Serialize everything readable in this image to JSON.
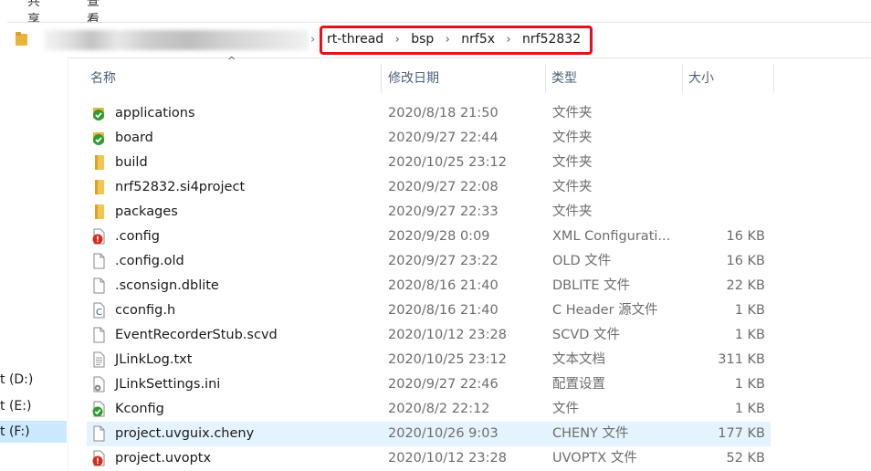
{
  "ribbon": {
    "tabs": [
      "共享",
      "查看"
    ]
  },
  "address": {
    "crumbs": [
      "rt-thread",
      "bsp",
      "nrf5x",
      "nrf52832"
    ],
    "highlight_color": "#e2121b"
  },
  "nav": {
    "drives": [
      {
        "label": "t (D:)",
        "selected": false
      },
      {
        "label": "t (E:)",
        "selected": false
      },
      {
        "label": "t (F:)",
        "selected": true
      }
    ]
  },
  "columns": {
    "name": "名称",
    "date": "修改日期",
    "type": "类型",
    "size": "大小"
  },
  "files": [
    {
      "icon": "folder-git-ok-icon",
      "name": "applications",
      "date": "2020/8/18 21:50",
      "type": "文件夹",
      "size": ""
    },
    {
      "icon": "folder-git-ok-icon",
      "name": "board",
      "date": "2020/9/27 22:44",
      "type": "文件夹",
      "size": ""
    },
    {
      "icon": "folder-icon",
      "name": "build",
      "date": "2020/10/25 23:12",
      "type": "文件夹",
      "size": ""
    },
    {
      "icon": "folder-icon",
      "name": "nrf52832.si4project",
      "date": "2020/9/27 22:08",
      "type": "文件夹",
      "size": ""
    },
    {
      "icon": "folder-icon",
      "name": "packages",
      "date": "2020/9/27 22:33",
      "type": "文件夹",
      "size": ""
    },
    {
      "icon": "file-git-modified-icon",
      "name": ".config",
      "date": "2020/9/28 0:09",
      "type": "XML Configurati...",
      "size": "16 KB"
    },
    {
      "icon": "file-icon",
      "name": ".config.old",
      "date": "2020/9/27 23:22",
      "type": "OLD 文件",
      "size": "16 KB"
    },
    {
      "icon": "file-icon",
      "name": ".sconsign.dblite",
      "date": "2020/8/16 21:40",
      "type": "DBLITE 文件",
      "size": "22 KB"
    },
    {
      "icon": "c-header-icon",
      "name": "cconfig.h",
      "date": "2020/8/16 21:40",
      "type": "C Header 源文件",
      "size": "1 KB"
    },
    {
      "icon": "file-icon",
      "name": "EventRecorderStub.scvd",
      "date": "2020/10/12 23:28",
      "type": "SCVD 文件",
      "size": "1 KB"
    },
    {
      "icon": "text-file-icon",
      "name": "JLinkLog.txt",
      "date": "2020/10/25 23:12",
      "type": "文本文档",
      "size": "311 KB"
    },
    {
      "icon": "settings-file-icon",
      "name": "JLinkSettings.ini",
      "date": "2020/9/27 22:46",
      "type": "配置设置",
      "size": "1 KB"
    },
    {
      "icon": "file-git-ok-icon",
      "name": "Kconfig",
      "date": "2020/8/2 22:12",
      "type": "文件",
      "size": "1 KB"
    },
    {
      "icon": "file-icon",
      "name": "project.uvguix.cheny",
      "date": "2020/10/26 9:03",
      "type": "CHENY 文件",
      "size": "177 KB",
      "highlighted": true
    },
    {
      "icon": "file-git-modified-icon",
      "name": "project.uvoptx",
      "date": "2020/10/12 23:28",
      "type": "UVOPTX 文件",
      "size": "52 KB"
    }
  ]
}
